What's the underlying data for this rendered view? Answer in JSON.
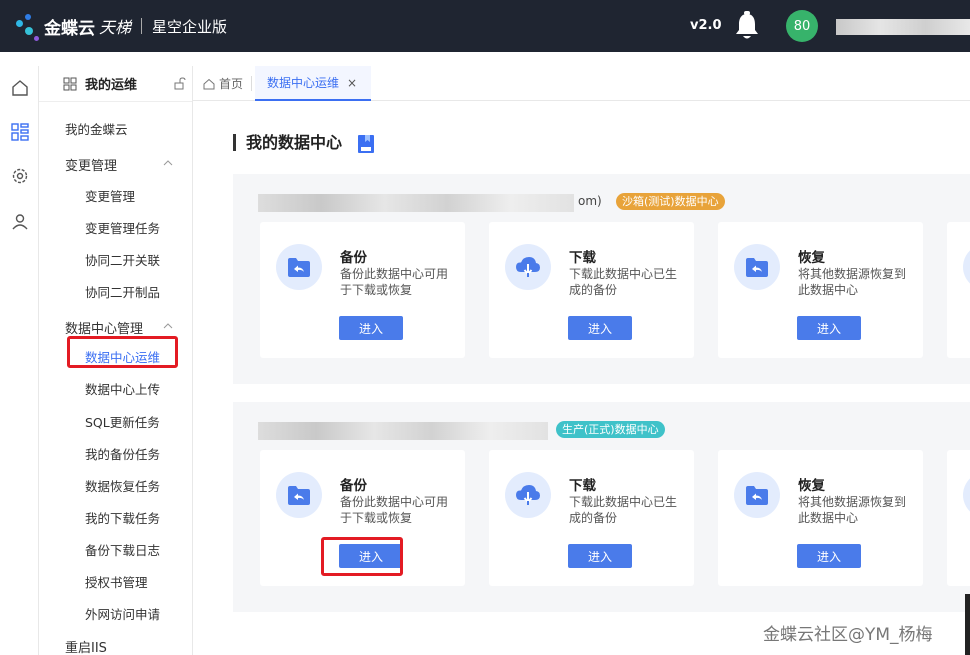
{
  "topbar": {
    "brand": "金蝶云",
    "brand_sub": "天梯",
    "edition": "星空企业版",
    "version": "v2.0",
    "avatar_text": "80"
  },
  "sidebar": {
    "header": "我的运维",
    "items": [
      {
        "label": "我的金蝶云"
      },
      {
        "label": "变更管理"
      },
      {
        "label": "变更管理"
      },
      {
        "label": "变更管理任务"
      },
      {
        "label": "协同二开关联"
      },
      {
        "label": "协同二开制品"
      },
      {
        "label": "数据中心管理"
      },
      {
        "label": "数据中心运维"
      },
      {
        "label": "数据中心上传"
      },
      {
        "label": "SQL更新任务"
      },
      {
        "label": "我的备份任务"
      },
      {
        "label": "数据恢复任务"
      },
      {
        "label": "我的下载任务"
      },
      {
        "label": "备份下载日志"
      },
      {
        "label": "授权书管理"
      },
      {
        "label": "外网访问申请"
      },
      {
        "label": "重启IIS"
      }
    ]
  },
  "tabs": {
    "home": "首页",
    "active": "数据中心运维",
    "close": "×"
  },
  "main": {
    "title": "我的数据中心",
    "datacenters": [
      {
        "host_suffix": "om)",
        "tag": "沙箱(测试)数据中心",
        "tag_color": "#e8a33a",
        "cards": [
          {
            "title": "备份",
            "desc": "备份此数据中心可用于下载或恢复",
            "button": "进入",
            "icon": "backup-icon"
          },
          {
            "title": "下载",
            "desc": "下载此数据中心已生成的备份",
            "button": "进入",
            "icon": "cloud-download-icon"
          },
          {
            "title": "恢复",
            "desc": "将其他数据源恢复到此数据中心",
            "button": "进入",
            "icon": "restore-icon"
          }
        ]
      },
      {
        "host_suffix": "",
        "tag": "生产(正式)数据中心",
        "tag_color": "#3fc2c9",
        "cards": [
          {
            "title": "备份",
            "desc": "备份此数据中心可用于下载或恢复",
            "button": "进入",
            "icon": "backup-icon"
          },
          {
            "title": "下载",
            "desc": "下载此数据中心已生成的备份",
            "button": "进入",
            "icon": "cloud-download-icon"
          },
          {
            "title": "恢复",
            "desc": "将其他数据源恢复到此数据中心",
            "button": "进入",
            "icon": "restore-icon"
          }
        ]
      }
    ]
  },
  "watermark": "金蝶云社区@YM_杨梅",
  "colors": {
    "accent": "#3b6ff2",
    "button": "#4a7bea",
    "highlight_box": "#e31b23",
    "topbar": "#1f2531"
  }
}
